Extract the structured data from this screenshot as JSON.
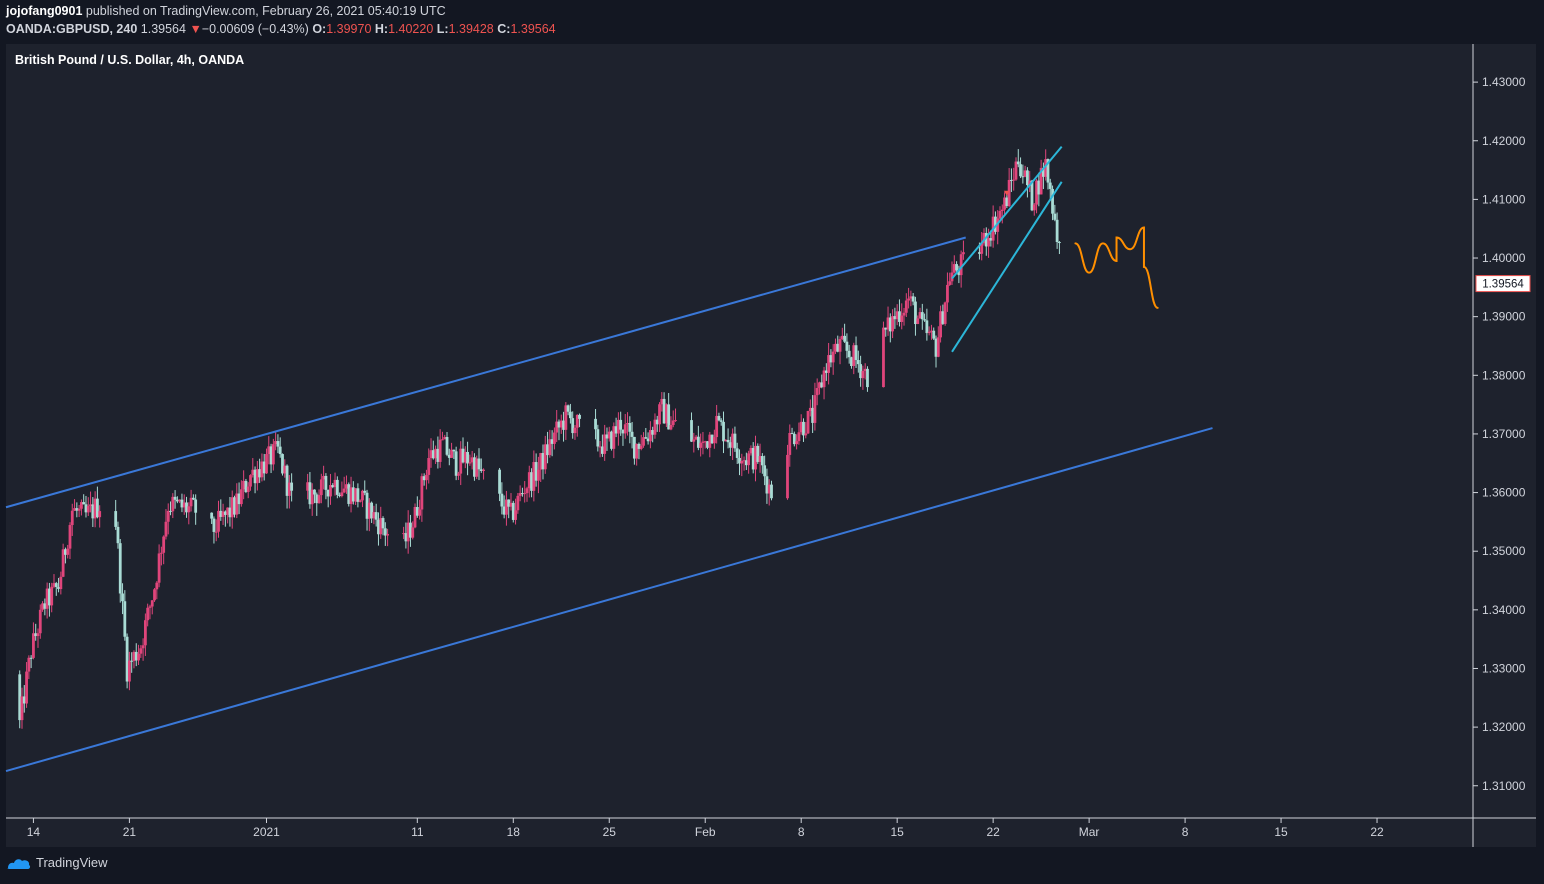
{
  "header": {
    "author": "jojofang0901",
    "published_text": "published on TradingView.com, February 26, 2021 05:40:19 UTC",
    "symbol": "OANDA:GBPUSD, 240",
    "last": "1.39564",
    "change_arrow": "▼",
    "change": "−0.00609 (−0.43%)",
    "o_label": "O:",
    "o_value": "1.39970",
    "h_label": "H:",
    "h_value": "1.40220",
    "l_label": "L:",
    "l_value": "1.39428",
    "c_label": "C:",
    "c_value": "1.39564"
  },
  "footer": {
    "brand": "TradingView",
    "logo_icon": "tradingview-logo-icon"
  },
  "colors": {
    "background": "#131722",
    "pane": "#1c1f2b",
    "up": "#e0457b",
    "down": "#a9dcd5",
    "channel": "#3a78d8",
    "wedge": "#2cb6d8",
    "projection": "#ff8f00",
    "price_marker": "#ef5350"
  },
  "chart_data": {
    "type": "candlestick",
    "title": "British Pound / U.S. Dollar, 4h, OANDA",
    "x_tick_labels": [
      "14",
      "21",
      "2021",
      "11",
      "18",
      "25",
      "Feb",
      "8",
      "15",
      "22",
      "Mar",
      "8",
      "15",
      "22"
    ],
    "y_tick_labels": [
      "1.43000",
      "1.42000",
      "1.41000",
      "1.40000",
      "1.39000",
      "1.38000",
      "1.37000",
      "1.36000",
      "1.35000",
      "1.34000",
      "1.33000",
      "1.32000",
      "1.31000"
    ],
    "y_ticks": [
      1.43,
      1.42,
      1.41,
      1.4,
      1.39,
      1.38,
      1.37,
      1.36,
      1.35,
      1.34,
      1.33,
      1.32,
      1.31
    ],
    "ylim": [
      1.3045,
      1.4365
    ],
    "date_range": [
      "2020-12-12",
      "2021-03-29"
    ],
    "last_price_label": "1.39564",
    "last_price": 1.39564,
    "price_path": [
      [
        "2020-12-12",
        1.329
      ],
      [
        "2020-12-13",
        1.318
      ],
      [
        "2020-12-14",
        1.333
      ],
      [
        "2020-12-15",
        1.341
      ],
      [
        "2020-12-16",
        1.344
      ],
      [
        "2020-12-17",
        1.357
      ],
      [
        "2020-12-18",
        1.356
      ],
      [
        "2020-12-20",
        1.36
      ],
      [
        "2020-12-21",
        1.33
      ],
      [
        "2020-12-22",
        1.334
      ],
      [
        "2020-12-23",
        1.344
      ],
      [
        "2020-12-24",
        1.358
      ],
      [
        "2020-12-26",
        1.357
      ],
      [
        "2020-12-27",
        1.353
      ],
      [
        "2020-12-29",
        1.358
      ],
      [
        "2020-12-30",
        1.363
      ],
      [
        "2021-01-01",
        1.367
      ],
      [
        "2021-01-02",
        1.359
      ],
      [
        "2021-01-04",
        1.36
      ],
      [
        "2021-01-05",
        1.362
      ],
      [
        "2021-01-07",
        1.359
      ],
      [
        "2021-01-08",
        1.356
      ],
      [
        "2021-01-10",
        1.35
      ],
      [
        "2021-01-11",
        1.356
      ],
      [
        "2021-01-12",
        1.366
      ],
      [
        "2021-01-13",
        1.368
      ],
      [
        "2021-01-14",
        1.365
      ],
      [
        "2021-01-15",
        1.366
      ],
      [
        "2021-01-17",
        1.359
      ],
      [
        "2021-01-18",
        1.356
      ],
      [
        "2021-01-19",
        1.361
      ],
      [
        "2021-01-20",
        1.364
      ],
      [
        "2021-01-21",
        1.369
      ],
      [
        "2021-01-22",
        1.373
      ],
      [
        "2021-01-24",
        1.369
      ],
      [
        "2021-01-25",
        1.368
      ],
      [
        "2021-01-26",
        1.372
      ],
      [
        "2021-01-27",
        1.368
      ],
      [
        "2021-01-28",
        1.37
      ],
      [
        "2021-01-29",
        1.374
      ],
      [
        "2021-01-31",
        1.369
      ],
      [
        "2021-02-01",
        1.368
      ],
      [
        "2021-02-02",
        1.372
      ],
      [
        "2021-02-03",
        1.369
      ],
      [
        "2021-02-04",
        1.366
      ],
      [
        "2021-02-05",
        1.366
      ],
      [
        "2021-02-06",
        1.36
      ],
      [
        "2021-02-07",
        1.368
      ],
      [
        "2021-02-08",
        1.371
      ],
      [
        "2021-02-09",
        1.373
      ],
      [
        "2021-02-10",
        1.382
      ],
      [
        "2021-02-11",
        1.385
      ],
      [
        "2021-02-12",
        1.383
      ],
      [
        "2021-02-13",
        1.38
      ],
      [
        "2021-02-14",
        1.386
      ],
      [
        "2021-02-15",
        1.39
      ],
      [
        "2021-02-16",
        1.393
      ],
      [
        "2021-02-17",
        1.388
      ],
      [
        "2021-02-18",
        1.385
      ],
      [
        "2021-02-19",
        1.397
      ],
      [
        "2021-02-20",
        1.399
      ],
      [
        "2021-02-21",
        1.401
      ],
      [
        "2021-02-22",
        1.405
      ],
      [
        "2021-02-23",
        1.409
      ],
      [
        "2021-02-24",
        1.417
      ],
      [
        "2021-02-25",
        1.41
      ],
      [
        "2021-02-26",
        1.416
      ],
      [
        "2021-02-27",
        1.402
      ],
      [
        "2021-02-27",
        1.39564
      ]
    ],
    "drawings": [
      {
        "name": "channel-upper-line",
        "from": [
          "2020-12-12",
          1.3575
        ],
        "to": [
          "2021-02-20",
          1.4035
        ]
      },
      {
        "name": "channel-lower-line",
        "from": [
          "2020-12-12",
          1.3125
        ],
        "to": [
          "2021-03-10",
          1.371
        ]
      },
      {
        "name": "wedge-upper-line",
        "from": [
          "2021-02-19",
          1.3965
        ],
        "to": [
          "2021-02-27",
          1.419
        ]
      },
      {
        "name": "wedge-lower-line",
        "from": [
          "2021-02-19",
          1.384
        ],
        "to": [
          "2021-02-27",
          1.413
        ]
      }
    ],
    "projection_path": [
      [
        "2021-02-28",
        1.4025
      ],
      [
        "2021-03-01",
        1.3975
      ],
      [
        "2021-03-02",
        1.4025
      ],
      [
        "2021-03-03",
        1.3995
      ],
      [
        "2021-03-03",
        1.4035
      ],
      [
        "2021-03-04",
        1.4015
      ],
      [
        "2021-03-05",
        1.4052
      ],
      [
        "2021-03-05",
        1.3985
      ],
      [
        "2021-03-06",
        1.3915
      ]
    ]
  }
}
